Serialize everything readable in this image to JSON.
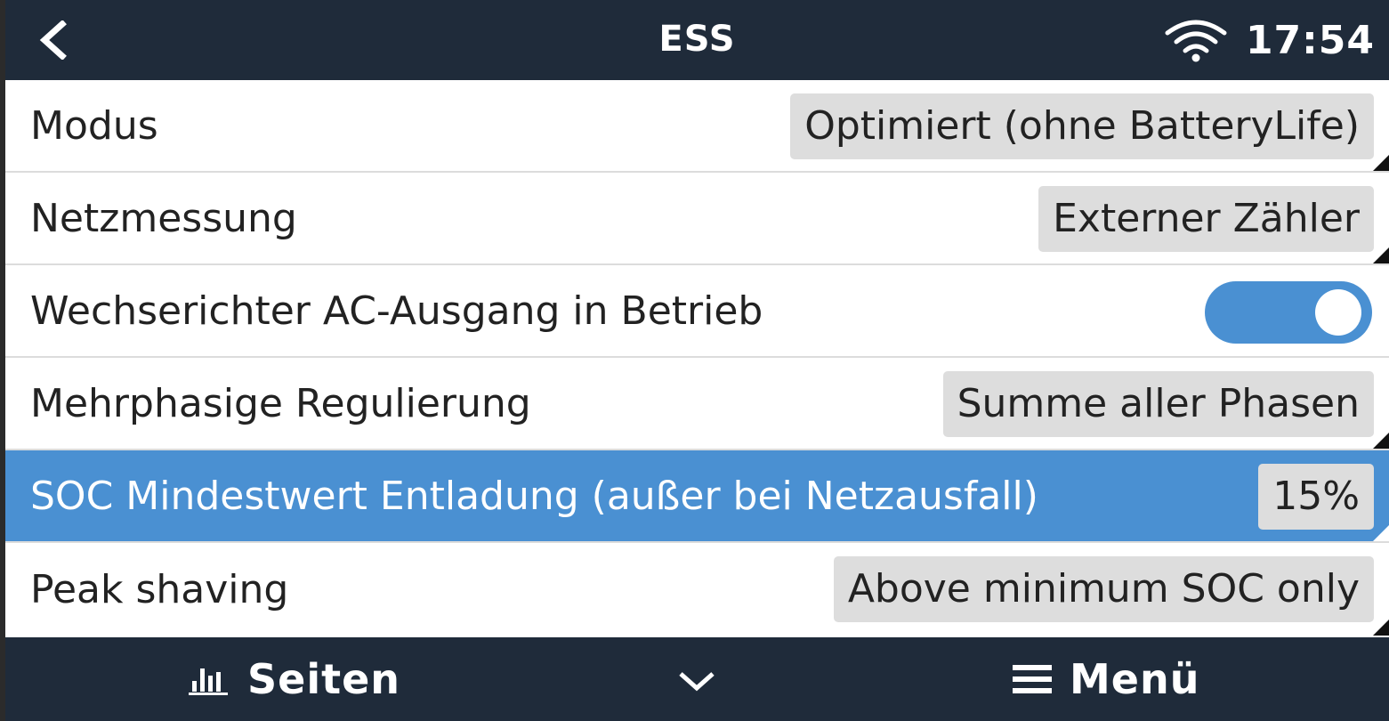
{
  "header": {
    "title": "ESS",
    "time": "17:54",
    "back_icon": "chevron-left-icon",
    "wifi_icon": "wifi-icon"
  },
  "settings": [
    {
      "label": "Modus",
      "value": "Optimiert (ohne BatteryLife)",
      "type": "select"
    },
    {
      "label": "Netzmessung",
      "value": "Externer Zähler",
      "type": "select"
    },
    {
      "label": "Wechserichter AC-Ausgang in Betrieb",
      "type": "toggle",
      "on": true
    },
    {
      "label": "Mehrphasige Regulierung",
      "value": "Summe aller Phasen",
      "type": "select"
    },
    {
      "label": "SOC Mindestwert Entladung (außer bei Netzausfall)",
      "value": "15%",
      "type": "select",
      "selected": true
    },
    {
      "label": "Peak shaving",
      "value": "Above minimum SOC only",
      "type": "select"
    }
  ],
  "footer": {
    "pages_label": "Seiten",
    "menu_label": "Menü",
    "pages_icon": "bar-chart-icon",
    "collapse_icon": "chevron-down-icon",
    "menu_icon": "hamburger-icon"
  },
  "colors": {
    "header_bg": "#1f2b3a",
    "accent": "#4a90d2",
    "value_bg": "#dddddd"
  }
}
